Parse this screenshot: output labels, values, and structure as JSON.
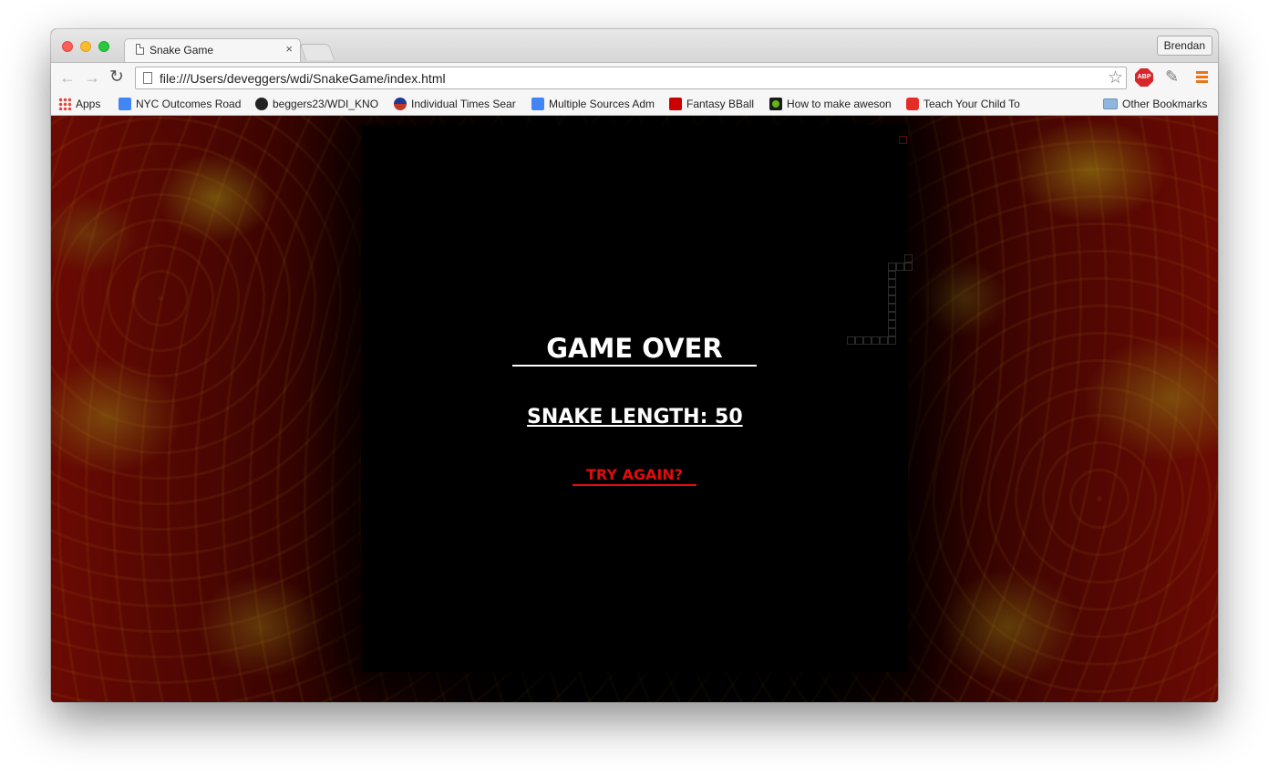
{
  "browser": {
    "tab": {
      "title": "Snake Game",
      "close_glyph": "×"
    },
    "profile_name": "Brendan",
    "nav": {
      "back_glyph": "←",
      "forward_glyph": "→",
      "reload_glyph": "↻"
    },
    "address_bar": {
      "url": "file:///Users/deveggers/wdi/SnakeGame/index.html",
      "star_glyph": "☆"
    },
    "extensions": {
      "abp_label": "ABP",
      "dropper_glyph": "✎"
    },
    "bookmarks": [
      {
        "label": "Apps",
        "icon": "apps-icon"
      },
      {
        "label": "NYC Outcomes Road",
        "icon": "google-docs-icon"
      },
      {
        "label": "beggers23/WDI_KNO",
        "icon": "github-icon"
      },
      {
        "label": "Individual Times Sear",
        "icon": "usa-swimming-icon"
      },
      {
        "label": "Multiple Sources Adm",
        "icon": "google-docs-icon"
      },
      {
        "label": "Fantasy BBall",
        "icon": "espn-icon"
      },
      {
        "label": "How to make aweson",
        "icon": "green-dot-icon"
      },
      {
        "label": "Teach Your Child To",
        "icon": "youtube-icon"
      }
    ],
    "other_bookmarks": "Other Bookmarks"
  },
  "game": {
    "title": "GAME OVER",
    "snake_length_label": "SNAKE LENGTH: 50",
    "try_again": "TRY AGAIN?"
  },
  "colors": {
    "lava_red": "#6b0a03",
    "lava_yellow": "#968c14",
    "retry_red": "#e00d0d"
  }
}
